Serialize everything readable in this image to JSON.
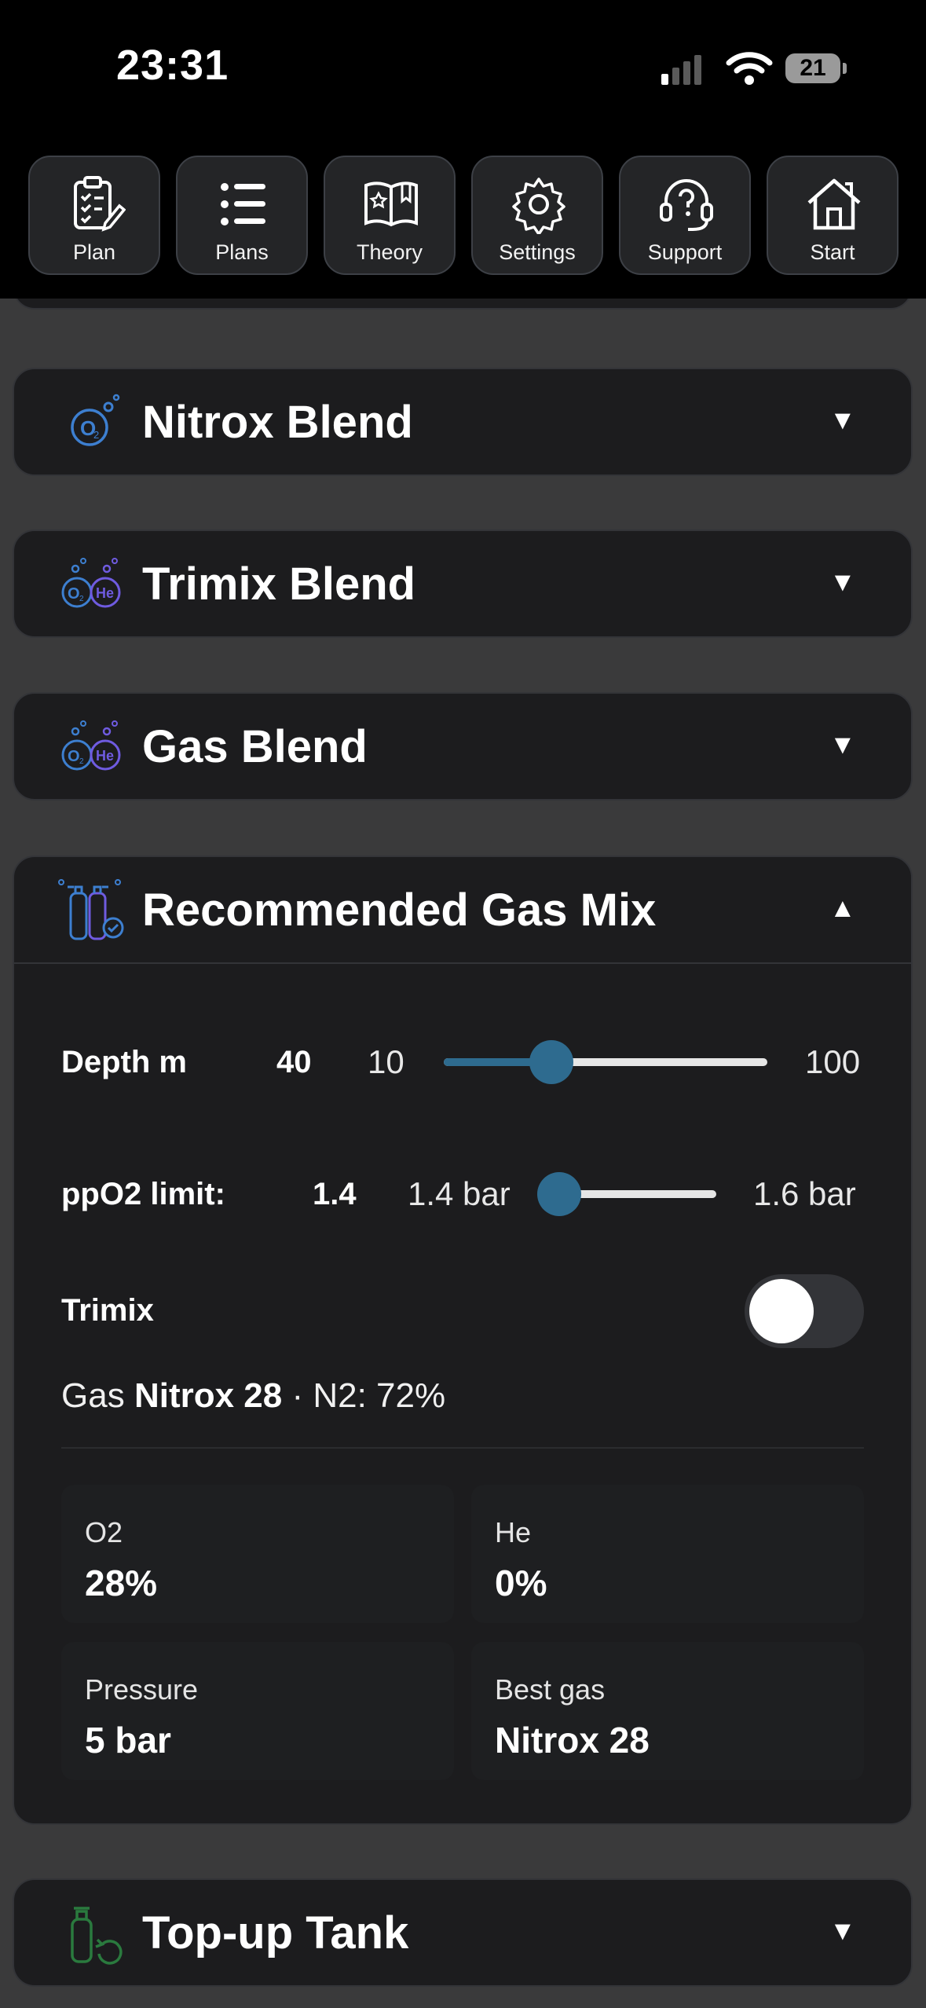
{
  "status_bar": {
    "time": "23:31",
    "battery": "21"
  },
  "toolbar": {
    "items": [
      {
        "label": "Plan",
        "icon": "clipboard-checklist-icon"
      },
      {
        "label": "Plans",
        "icon": "list-icon"
      },
      {
        "label": "Theory",
        "icon": "book-icon"
      },
      {
        "label": "Settings",
        "icon": "gear-icon"
      },
      {
        "label": "Support",
        "icon": "headset-question-icon"
      },
      {
        "label": "Start",
        "icon": "home-icon"
      }
    ]
  },
  "sections": [
    {
      "title": "Nitrox Blend",
      "icon": "o2-bubble-icon",
      "chevron": "▼"
    },
    {
      "title": "Trimix Blend",
      "icon": "o2-he-bubbles-icon",
      "chevron": "▼"
    },
    {
      "title": "Gas Blend",
      "icon": "o2-he-bubbles-icon",
      "chevron": "▼"
    },
    {
      "title": "Recommended Gas Mix",
      "icon": "gas-cylinders-check-icon",
      "chevron": "▲"
    },
    {
      "title": "Top-up Tank",
      "icon": "tank-refill-icon",
      "chevron": "▼"
    }
  ],
  "recommended": {
    "depth": {
      "label": "Depth m",
      "value": "40",
      "min": "10",
      "max": "100",
      "fraction": 0.333
    },
    "ppo2": {
      "label": "ppO2 limit:",
      "value": "1.4",
      "min": "1.4 bar",
      "max": "1.6 bar",
      "fraction": 0.0
    },
    "trimix": {
      "label": "Trimix",
      "enabled": false
    },
    "gas_summary": {
      "prefix": "Gas",
      "name": "Nitrox 28",
      "suffix": "· N2: 72%"
    },
    "stats": [
      {
        "label": "O2",
        "value": "28%"
      },
      {
        "label": "He",
        "value": "0%"
      },
      {
        "label": "Pressure",
        "value": "5 bar"
      },
      {
        "label": "Best gas",
        "value": "Nitrox 28"
      }
    ]
  },
  "colors": {
    "accent": "#2e6b8f",
    "card_bg": "#1c1c1e",
    "page_bg": "#3a3a3b",
    "icon_blue": "#3d7fd0",
    "icon_purple": "#6f5be0",
    "icon_green": "#2a7a3e"
  }
}
